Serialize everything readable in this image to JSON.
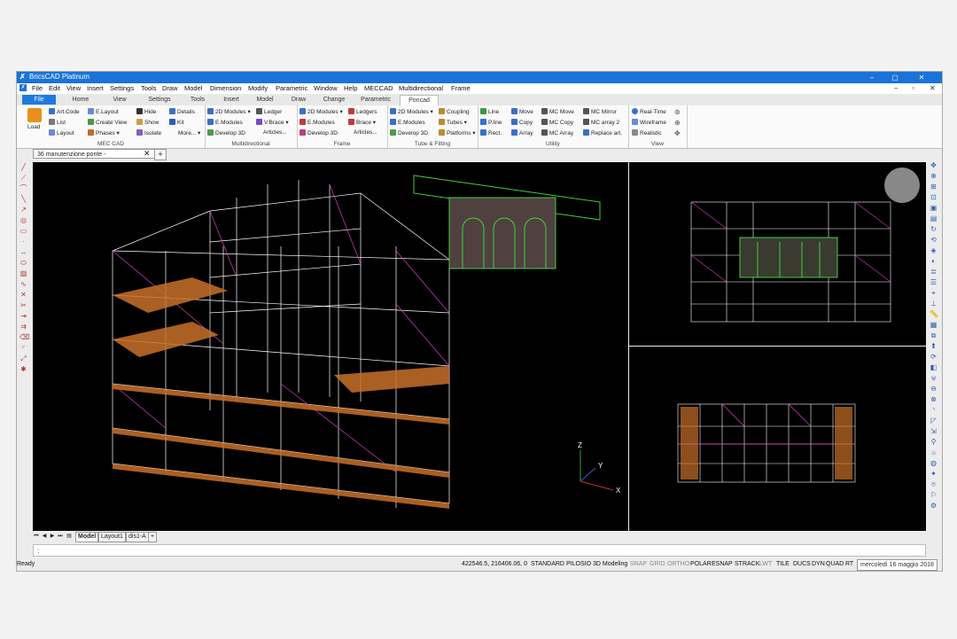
{
  "window": {
    "title": "BricsCAD Platinum",
    "minimize": "–",
    "maximize": "▢",
    "close": "✕"
  },
  "menu": [
    "File",
    "Edit",
    "View",
    "Insert",
    "Settings",
    "Tools",
    "Draw",
    "Model",
    "Dimension",
    "Modify",
    "Parametric",
    "Window",
    "Help",
    "MECCAD",
    "Multidirectional",
    "Frame"
  ],
  "tabs": [
    "File",
    "Home",
    "View",
    "Settings",
    "Tools",
    "Insert",
    "Model",
    "Draw",
    "Change",
    "Parametric",
    "Poncad"
  ],
  "ribbon": {
    "meccad": {
      "title": "MEC CAD",
      "load": "Load",
      "items": [
        "Art.Code",
        "List",
        "Layout",
        "E.Layout",
        "Create View",
        "Phases ▾",
        "Hide",
        "Show",
        "Isolate",
        "Details",
        "Kit",
        "More... ▾"
      ]
    },
    "multidirectional": {
      "title": "Multidirectional",
      "items": [
        "2D Modules ▾",
        "E.Modules",
        "Develop 3D",
        "Ledger",
        "V.Brace ▾",
        "Articles..."
      ]
    },
    "frame": {
      "title": "Frame",
      "items": [
        "2D Modules ▾",
        "E.Modules",
        "Develop 3D",
        "Ledgers",
        "Brace ▾",
        "Articles..."
      ]
    },
    "tube": {
      "title": "Tube & Fitting",
      "items": [
        "2D Modules ▾",
        "E.Modules",
        "Develop 3D",
        "Coupling",
        "Tubes ▾",
        "Platforms ▾"
      ]
    },
    "utility": {
      "title": "Utility",
      "items": [
        "Line",
        "P.line",
        "Rect.",
        "Move",
        "Copy",
        "Array",
        "MC Move",
        "MC Copy",
        "MC Array",
        "MC Mirror",
        "MC array 2",
        "Replace art."
      ]
    },
    "view": {
      "title": "View",
      "items": [
        "Real-Time",
        "Wireframe",
        "Realistic"
      ]
    }
  },
  "document_tab": "36 manutenzione ponte -",
  "layout_tabs": [
    "Model",
    "Layout1",
    "dis1-A"
  ],
  "command_prompt": ":",
  "status": {
    "ready": "Ready",
    "coords": "422546.5, 216406.06, 0",
    "items": [
      "STANDARD",
      "PILOSIO",
      "3D Modeling",
      "SNAP",
      "GRID",
      "ORTHO",
      "POLAR",
      "ESNAP",
      "STRACK",
      "LWT",
      "TILE",
      "DUCS",
      "DYN",
      "QUAD",
      "RT"
    ],
    "off_items": [
      "SNAP",
      "GRID",
      "ORTHO",
      "LWT"
    ],
    "date": "mercoledì 16 maggio 2018"
  },
  "viewport": {
    "axis_x": "X",
    "axis_y": "Y",
    "axis_z": "Z"
  },
  "colors": {
    "title_bar": "#1a73d9",
    "viewport_bg": "#000000",
    "frame_white": "#ffffff",
    "brace_magenta": "#d040c0",
    "plank_orange": "#c8702a",
    "bridge_green": "#40d040"
  }
}
